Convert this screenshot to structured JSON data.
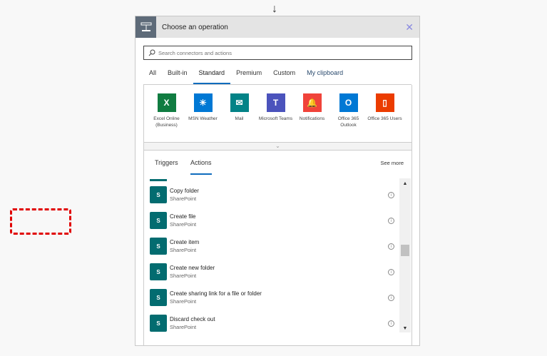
{
  "header": {
    "title": "Choose an operation"
  },
  "search": {
    "placeholder": "Search connectors and actions"
  },
  "tabs": [
    "All",
    "Built-in",
    "Standard",
    "Premium",
    "Custom",
    "My clipboard"
  ],
  "connectors": [
    {
      "label": "Excel Online (Business)",
      "color": "#107c41",
      "glyph": "X"
    },
    {
      "label": "MSN Weather",
      "color": "#0078d4",
      "glyph": "☀"
    },
    {
      "label": "Mail",
      "color": "#038387",
      "glyph": "✉"
    },
    {
      "label": "Microsoft Teams",
      "color": "#4b53bc",
      "glyph": "T"
    },
    {
      "label": "Notifications",
      "color": "#f0433a",
      "glyph": "🔔"
    },
    {
      "label": "Office 365 Outlook",
      "color": "#0078d4",
      "glyph": "O"
    },
    {
      "label": "Office 365 Users",
      "color": "#eb3c00",
      "glyph": "▯"
    }
  ],
  "subtabs": {
    "triggers": "Triggers",
    "actions": "Actions",
    "see_more": "See more"
  },
  "actions": [
    {
      "name": "Copy folder",
      "connector": "SharePoint"
    },
    {
      "name": "Create file",
      "connector": "SharePoint"
    },
    {
      "name": "Create item",
      "connector": "SharePoint"
    },
    {
      "name": "Create new folder",
      "connector": "SharePoint"
    },
    {
      "name": "Create sharing link for a file or folder",
      "connector": "SharePoint"
    },
    {
      "name": "Discard check out",
      "connector": "SharePoint"
    }
  ]
}
